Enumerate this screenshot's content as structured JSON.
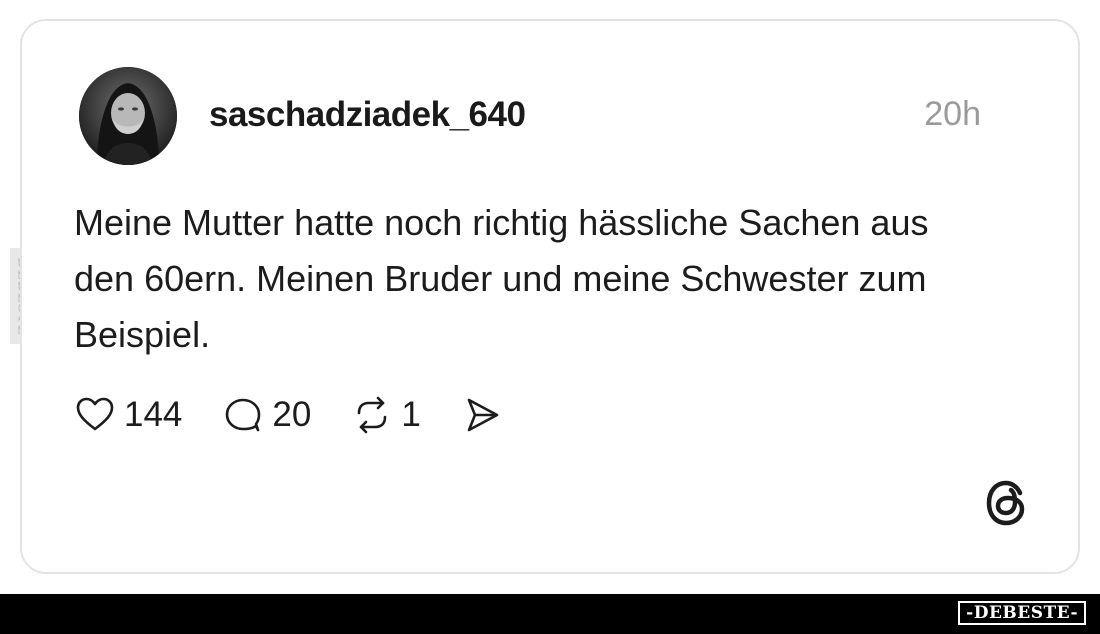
{
  "post": {
    "username": "saschadziadek_640",
    "timestamp": "20h",
    "text": "Meine Mutter hatte noch richtig hässliche Sachen aus den 60ern. Meinen Bruder und meine Schwester zum Beispiel."
  },
  "actions": {
    "likes": "144",
    "comments": "20",
    "reposts": "1"
  },
  "icons": {
    "like": "heart-icon",
    "comment": "comment-icon",
    "repost": "repost-icon",
    "share": "send-icon",
    "brand": "threads-logo-icon"
  },
  "watermark": {
    "side": "DEBESTE",
    "stamp": "-DEBESTE-"
  },
  "colors": {
    "text": "#1c1c1c",
    "muted": "#9a9a9a",
    "border": "#e3e3e3",
    "bar": "#000000"
  }
}
